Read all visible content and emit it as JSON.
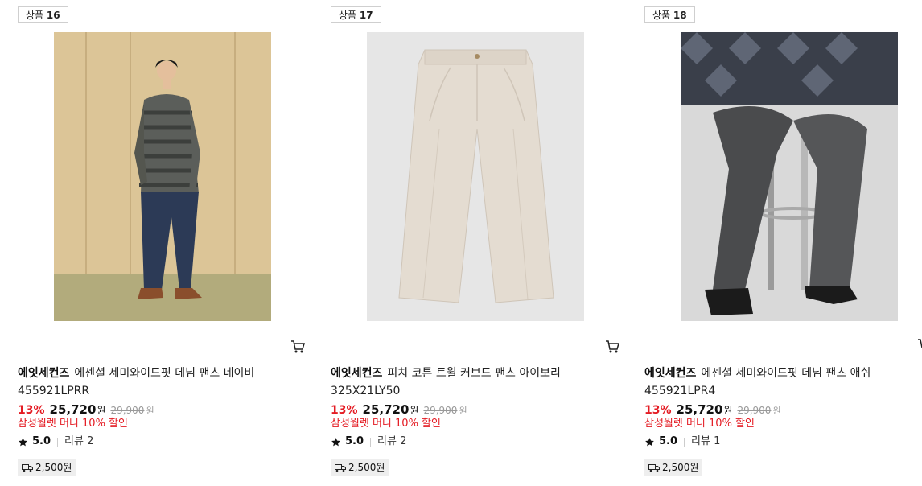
{
  "products": [
    {
      "badge_prefix": "상품",
      "badge_number": "16",
      "brand": "에잇세컨즈",
      "name": "에센셜 세미와이드핏 데님 팬츠 네이비",
      "code": "455921LPRR",
      "discount": "13%",
      "sale_price": "25,720",
      "currency": "원",
      "original_price": "29,900",
      "promo": "삼성월렛 머니 10% 할인",
      "rating": "5.0",
      "reviews": "리뷰 2",
      "shipping": "2,500원"
    },
    {
      "badge_prefix": "상품",
      "badge_number": "17",
      "brand": "에잇세컨즈",
      "name": "피치 코튼 트윌 커브드 팬츠 아이보리",
      "code": "325X21LY50",
      "discount": "13%",
      "sale_price": "25,720",
      "currency": "원",
      "original_price": "29,900",
      "promo": "삼성월렛 머니 10% 할인",
      "rating": "5.0",
      "reviews": "리뷰 2",
      "shipping": "2,500원"
    },
    {
      "badge_prefix": "상품",
      "badge_number": "18",
      "brand": "에잇세컨즈",
      "name": "에센셜 세미와이드핏 데님 팬츠 애쉬",
      "code": "455921LPR4",
      "discount": "13%",
      "sale_price": "25,720",
      "currency": "원",
      "original_price": "29,900",
      "promo": "삼성월렛 머니 10% 할인",
      "rating": "5.0",
      "reviews": "리뷰 1",
      "shipping": "2,500원"
    }
  ],
  "colors": {
    "discount": "#e41b23",
    "promo": "#e41b23",
    "strike": "#999999",
    "ship_bg": "#eeeeee"
  },
  "icons": {
    "cart": "cart-icon",
    "star": "star-icon",
    "shipping": "truck-icon"
  }
}
